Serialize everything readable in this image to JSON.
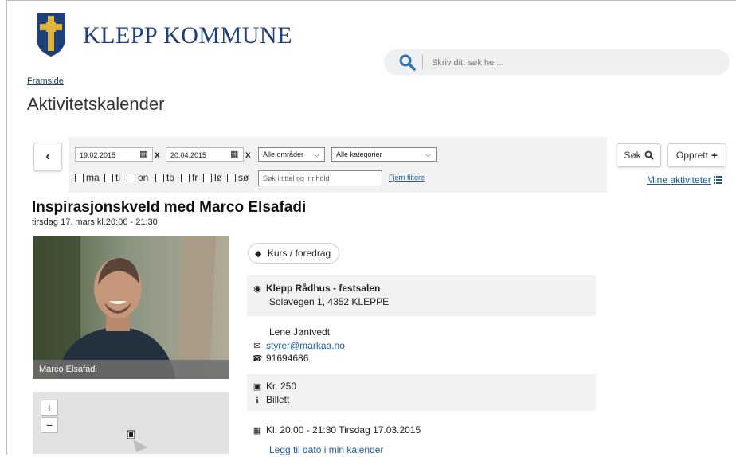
{
  "header": {
    "brand": "KLEPP KOMMUNE",
    "search_placeholder": "Skriv ditt søk her..."
  },
  "breadcrumb": {
    "home": "Framside"
  },
  "page_title": "Aktivitetskalender",
  "filter": {
    "date_from": "19.02.2015",
    "date_to": "20.04.2015",
    "clear_symbol": "x",
    "area_select": "Alle områder",
    "category_select": "Alle kategorier",
    "days": [
      "ma",
      "ti",
      "on",
      "to",
      "fr",
      "lø",
      "sø"
    ],
    "text_search_placeholder": "Søk i tittel og innhold",
    "clear_filters": "Fjern filtere",
    "search_button": "Søk",
    "create_button": "Opprett",
    "my_activities": "Mine aktiviteter"
  },
  "event": {
    "title": "Inspirasjonskveld med Marco Elsafadi",
    "date_line": "tirsdag 17. mars kl.20:00 - 21:30",
    "photo_caption": "Marco Elsafadi",
    "category_tag": "Kurs / foredrag",
    "venue_name": "Klepp Rådhus - festsalen",
    "venue_address": "Solavegen 1, 4352 KLEPPE",
    "contact_name": "Lene Jøntvedt",
    "contact_email": "styrer@markaa.no",
    "contact_phone": "91694686",
    "price": "Kr. 250",
    "ticket": "Billett",
    "time_line": "Kl. 20:00 - 21:30 Tirsdag 17.03.2015",
    "add_to_calendar": "Legg til dato i min kalender"
  },
  "map": {
    "zoom_in": "+",
    "zoom_out": "−"
  },
  "colors": {
    "brand_blue": "#1f3f78",
    "link_blue": "#1f5a99",
    "panel_gray": "#f2f2f2"
  }
}
